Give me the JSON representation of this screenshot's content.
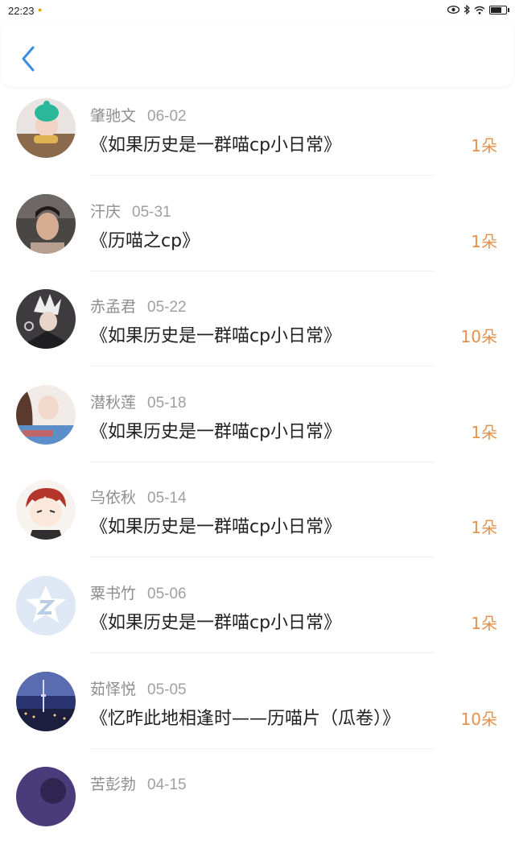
{
  "status": {
    "time": "22:23"
  },
  "nav": {
    "back_icon": "chevron-left-icon",
    "accent_color": "#3b8de0"
  },
  "colors": {
    "count": "#e5914a",
    "username": "#8e8e8e",
    "title": "#222222"
  },
  "items": [
    {
      "name": "肇驰文",
      "date": "06-02",
      "title": "《如果历史是一群喵cp小日常》",
      "count": "1朵"
    },
    {
      "name": "汗庆",
      "date": "05-31",
      "title": "《历喵之cp》",
      "count": "1朵"
    },
    {
      "name": "赤孟君",
      "date": "05-22",
      "title": "《如果历史是一群喵cp小日常》",
      "count": "10朵"
    },
    {
      "name": "潜秋莲",
      "date": "05-18",
      "title": "《如果历史是一群喵cp小日常》",
      "count": "1朵"
    },
    {
      "name": "乌依秋",
      "date": "05-14",
      "title": "《如果历史是一群喵cp小日常》",
      "count": "1朵"
    },
    {
      "name": "粟书竹",
      "date": "05-06",
      "title": "《如果历史是一群喵cp小日常》",
      "count": "1朵"
    },
    {
      "name": "茹怿悦",
      "date": "05-05",
      "title": "《忆昨此地相逢时——历喵片（瓜卷）》",
      "count": "10朵"
    },
    {
      "name": "苦彭勃",
      "date": "04-15",
      "title": "",
      "count": ""
    }
  ]
}
